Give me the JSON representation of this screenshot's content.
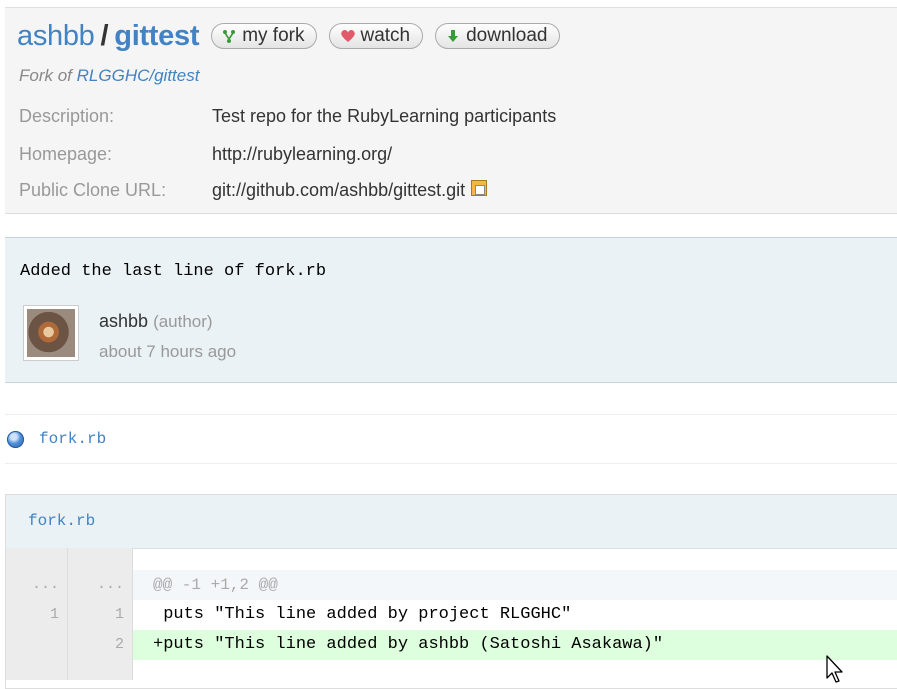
{
  "repo": {
    "owner": "ashbb",
    "separator": "/",
    "name": "gittest",
    "buttons": {
      "fork": "my fork",
      "watch": "watch",
      "download": "download"
    },
    "fork_of_label": "Fork of",
    "fork_of_link": "RLGGHC/gittest",
    "description_label": "Description:",
    "description": "Test repo for the RubyLearning participants",
    "homepage_label": "Homepage:",
    "homepage": "http://rubylearning.org/",
    "clone_label": "Public Clone URL:",
    "clone_url": "git://github.com/ashbb/gittest.git"
  },
  "commit": {
    "message": "Added the last line of fork.rb",
    "author": "ashbb",
    "author_role": "(author)",
    "time": "about 7 hours ago"
  },
  "files": [
    {
      "name": "fork.rb"
    }
  ],
  "diff": {
    "file": "fork.rb",
    "hunk_old": "...",
    "hunk_new": "...",
    "hunk": "@@ -1 +1,2 @@",
    "lines": [
      {
        "old": "1",
        "new": "1",
        "text": " puts \"This line added by project RLGGHC\""
      },
      {
        "old": "",
        "new": "2",
        "text": "+puts \"This line added by ashbb (Satoshi Asakawa)\""
      }
    ]
  },
  "colors": {
    "link": "#4183c4",
    "added_line_bg": "#ddffdd",
    "commit_bg": "#eaf2f5"
  }
}
